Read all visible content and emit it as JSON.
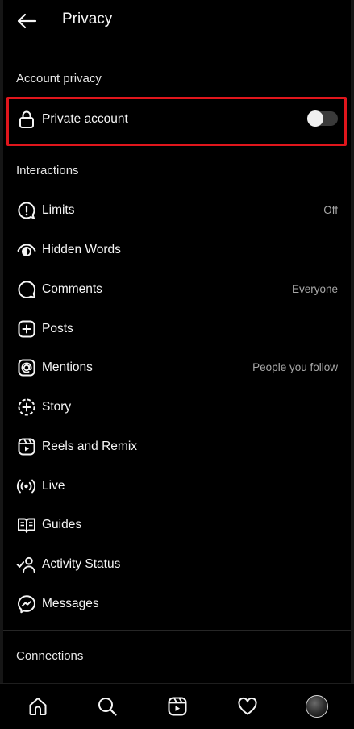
{
  "header": {
    "title": "Privacy",
    "back_icon": "arrow-left-icon"
  },
  "account_privacy": {
    "heading": "Account privacy",
    "private_account": {
      "label": "Private account",
      "icon": "lock-icon",
      "enabled": false
    }
  },
  "interactions": {
    "heading": "Interactions",
    "items": [
      {
        "label": "Limits",
        "value": "Off",
        "icon": "limits-icon"
      },
      {
        "label": "Hidden Words",
        "value": "",
        "icon": "hidden-words-icon"
      },
      {
        "label": "Comments",
        "value": "Everyone",
        "icon": "comment-icon"
      },
      {
        "label": "Posts",
        "value": "",
        "icon": "add-post-icon"
      },
      {
        "label": "Mentions",
        "value": "People you follow",
        "icon": "mention-icon"
      },
      {
        "label": "Story",
        "value": "",
        "icon": "story-icon"
      },
      {
        "label": "Reels and Remix",
        "value": "",
        "icon": "reels-icon"
      },
      {
        "label": "Live",
        "value": "",
        "icon": "live-icon"
      },
      {
        "label": "Guides",
        "value": "",
        "icon": "guides-icon"
      },
      {
        "label": "Activity Status",
        "value": "",
        "icon": "activity-status-icon"
      },
      {
        "label": "Messages",
        "value": "",
        "icon": "messenger-icon"
      }
    ]
  },
  "connections": {
    "heading": "Connections"
  },
  "bottom_nav": [
    "home-icon",
    "search-icon",
    "reels-icon",
    "heart-icon",
    "profile-avatar"
  ],
  "colors": {
    "background": "#000000",
    "text": "#f5f5f5",
    "secondary_text": "#a8a8a8",
    "highlight_border": "#e0161c"
  }
}
